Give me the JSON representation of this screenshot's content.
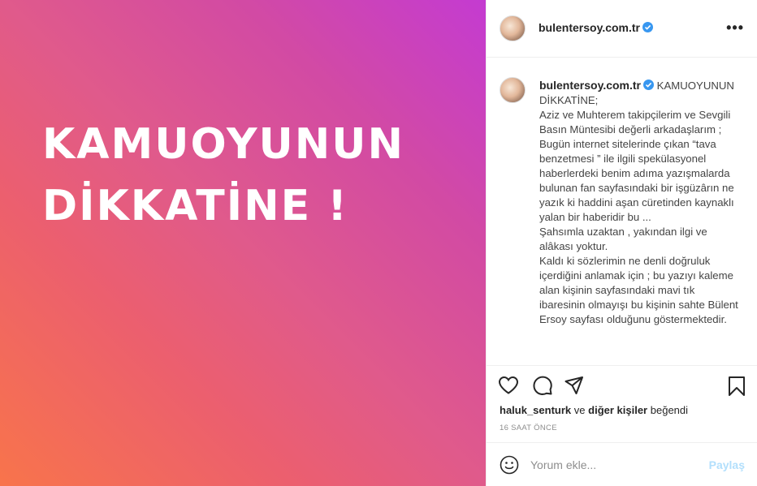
{
  "post": {
    "headline_line1": "KAMUOYUNUN",
    "headline_line2": "DİKKATİNE !"
  },
  "header": {
    "username": "bulentersoy.com.tr",
    "more_label": "•••"
  },
  "caption": {
    "username": "bulentersoy.com.tr",
    "lines": [
      "KAMUOYUNUN DİKKATİNE;",
      "Aziz ve Muhterem takipçilerim ve Sevgili Basın Müntesibi değerli arkadaşlarım ;",
      "Bugün internet sitelerinde çıkan “tava benzetmesi ” ile ilgili spekülasyonel haberlerdeki benim adıma yazışmalarda bulunan fan sayfasındaki bir işgüzârın ne yazık ki haddini aşan cüretinden kaynaklı yalan bir haberidir bu ...",
      "Şahsımla uzaktan , yakından ilgi ve alâkası yoktur.",
      "Kaldı ki sözlerimin ne denli doğruluk içerdiğini anlamak için ; bu yazıyı kaleme alan kişinin sayfasındaki mavi tık ibaresinin olmayışı bu kişinin sahte Bülent Ersoy sayfası olduğunu göstermektedir."
    ]
  },
  "likes": {
    "user": "haluk_senturk",
    "connector": "ve",
    "others": "diğer kişiler",
    "suffix": "beğendi"
  },
  "time_label": "16 SAAT ÖNCE",
  "comment": {
    "placeholder": "Yorum ekle...",
    "share_label": "Paylaş"
  },
  "icons": [
    "heart-icon",
    "comment-icon",
    "share-icon",
    "bookmark-icon",
    "emoji-icon",
    "verified-icon",
    "more-icon"
  ]
}
